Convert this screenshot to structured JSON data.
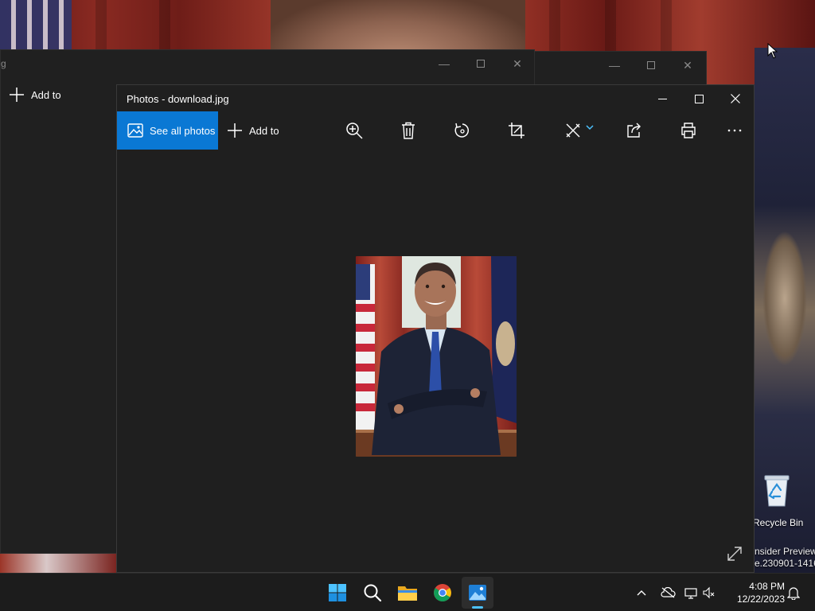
{
  "desktop": {
    "recycle_bin_label": "Recycle Bin",
    "watermark_line1": "nsider Preview",
    "watermark_line2": "e.230901-1416"
  },
  "background_window": {
    "title_fragment": "g",
    "add_to_label": "Add to"
  },
  "photos_window": {
    "title": "Photos - download.jpg",
    "toolbar": {
      "see_all_photos_label": "See all photos",
      "add_to_label": "Add to",
      "icons": [
        "zoom-in-icon",
        "delete-icon",
        "rotate-icon",
        "crop-icon",
        "edit-icon",
        "share-icon",
        "print-icon",
        "more-icon"
      ]
    },
    "accent_color": "#0a78d4"
  },
  "taskbar": {
    "apps": [
      "start",
      "search",
      "file-explorer",
      "chrome",
      "photos"
    ],
    "active_app": "photos",
    "time": "4:08 PM",
    "date": "12/22/2023"
  }
}
